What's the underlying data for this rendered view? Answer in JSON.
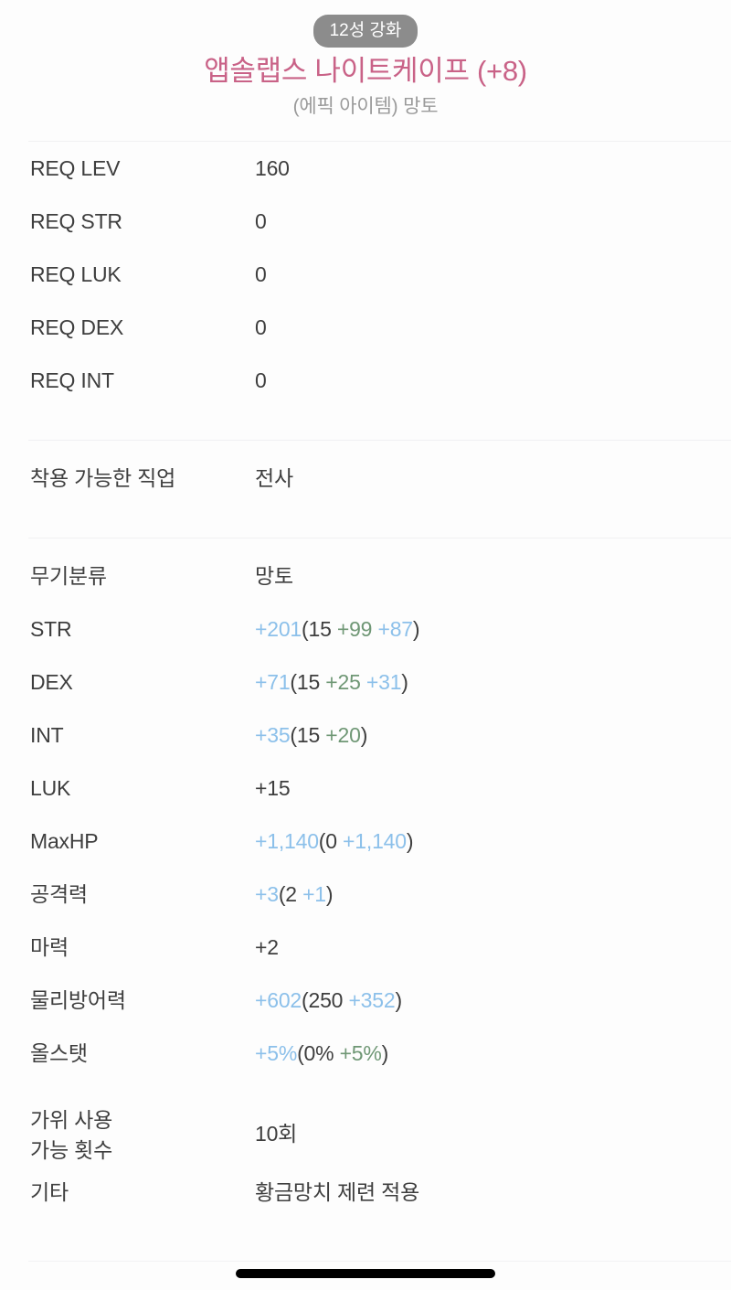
{
  "header": {
    "badge": "12성 강화",
    "title": "앱솔랩스 나이트케이프 (+8)",
    "subtitle": "(에픽 아이템) 망토"
  },
  "colors": {
    "title_pink": "#c96287",
    "badge_gray": "#8c8c8c",
    "stat_blue": "#8cc0ea",
    "increment_green": "#6f9775",
    "text_dark": "#3e3e3e",
    "label_gray": "#9a9a9a",
    "gold": "#c9a83c",
    "divider": "#f0f0f2",
    "background": "#fdfdfd"
  },
  "requirements": [
    {
      "label": "REQ LEV",
      "value": "160"
    },
    {
      "label": "REQ STR",
      "value": "0"
    },
    {
      "label": "REQ LUK",
      "value": "0"
    },
    {
      "label": "REQ DEX",
      "value": "0"
    },
    {
      "label": "REQ INT",
      "value": "0"
    }
  ],
  "job": {
    "label": "착용 가능한 직업",
    "value": "전사"
  },
  "category": {
    "label": "무기분류",
    "value": "망토"
  },
  "stats": [
    {
      "label": "STR",
      "label_color": "blue",
      "total": "+201",
      "total_color": "blue",
      "base": "15",
      "increments": [
        {
          "text": "+99",
          "color": "green"
        },
        {
          "text": "+87",
          "color": "blue"
        }
      ]
    },
    {
      "label": "DEX",
      "label_color": "blue",
      "total": "+71",
      "total_color": "blue",
      "base": "15",
      "increments": [
        {
          "text": "+25",
          "color": "green"
        },
        {
          "text": "+31",
          "color": "blue"
        }
      ]
    },
    {
      "label": "INT",
      "label_color": "blue",
      "total": "+35",
      "total_color": "blue",
      "base": "15",
      "increments": [
        {
          "text": "+20",
          "color": "green"
        }
      ]
    },
    {
      "label": "LUK",
      "label_color": "dark",
      "total": "+15",
      "total_color": "dark",
      "base": "",
      "increments": []
    },
    {
      "label": "MaxHP",
      "label_color": "blue",
      "total": "+1,140",
      "total_color": "blue",
      "base": "0",
      "increments": [
        {
          "text": "+1,140",
          "color": "blue"
        }
      ]
    },
    {
      "label": "공격력",
      "label_color": "blue",
      "total": "+3",
      "total_color": "blue",
      "base": "2",
      "increments": [
        {
          "text": "+1",
          "color": "blue"
        }
      ]
    },
    {
      "label": "마력",
      "label_color": "dark",
      "total": "+2",
      "total_color": "dark",
      "base": "",
      "increments": []
    },
    {
      "label": "물리방어력",
      "label_color": "blue",
      "total": "+602",
      "total_color": "blue",
      "base": "250",
      "increments": [
        {
          "text": "+352",
          "color": "blue"
        }
      ]
    },
    {
      "label": "올스탯",
      "label_color": "blue",
      "total": "+5%",
      "total_color": "blue",
      "base": "0%",
      "increments": [
        {
          "text": "+5%",
          "color": "green"
        }
      ]
    }
  ],
  "scissors": {
    "label": "가위 사용\n가능 횟수",
    "value": "10회"
  },
  "etc": {
    "label": "기타",
    "value": "황금망치 제련 적용"
  }
}
